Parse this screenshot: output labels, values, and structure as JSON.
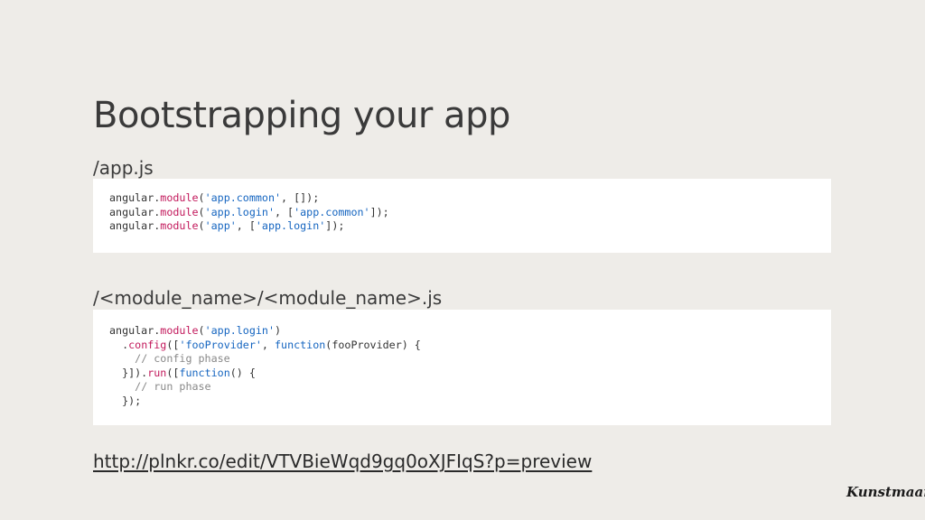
{
  "slide": {
    "title": "Bootstrapping your app",
    "section1_label": "/app.js",
    "section2_label": "/<module_name>/<module_name>.js",
    "link": "http://plnkr.co/edit/VTVBieWqd9gq0oXJFIqS?p=preview",
    "logo_text": "Kunstmaan"
  },
  "code1": {
    "l1": [
      "angular.",
      "module",
      "(",
      "'app.common'",
      ", []);"
    ],
    "l2": [
      "angular.",
      "module",
      "(",
      "'app.login'",
      ", [",
      "'app.common'",
      "]);"
    ],
    "l3": [
      "angular.",
      "module",
      "(",
      "'app'",
      ", [",
      "'app.login'",
      "]);"
    ]
  },
  "code2": {
    "l1": [
      "angular.",
      "module",
      "(",
      "'app.login'",
      ")"
    ],
    "l2": [
      "  .",
      "config",
      "([",
      "'fooProvider'",
      ", ",
      "function",
      "(fooProvider) {"
    ],
    "l3": [
      "    ",
      "// config phase"
    ],
    "l4": [
      "  }]).",
      "run",
      "([",
      "function",
      "() {"
    ],
    "l5": [
      "    ",
      "// run phase"
    ],
    "l6": [
      "  });"
    ]
  },
  "colors": {
    "background": "#eeece8",
    "code_function": "#c2185b",
    "code_string": "#1565c0",
    "code_comment": "#888888"
  }
}
